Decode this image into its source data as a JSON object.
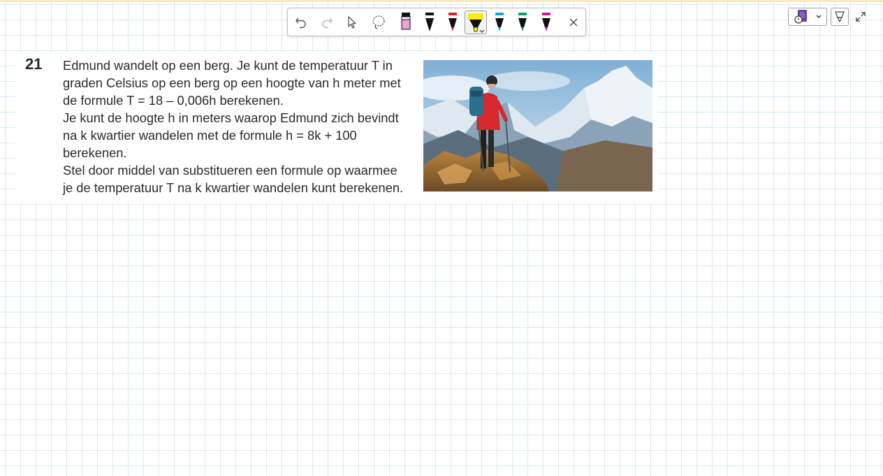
{
  "colors": {
    "grid_line": "#d7e9f5",
    "toolbar_border": "#bdbdbd",
    "highlighter_yellow": "#f5f000"
  },
  "toolbar": {
    "tools": [
      {
        "name": "undo-icon"
      },
      {
        "name": "redo-icon"
      },
      {
        "name": "select-pointer-icon"
      },
      {
        "name": "lasso-icon"
      },
      {
        "name": "pen-black-pink-icon",
        "tip": "#111111",
        "body": "#e4a6d6"
      },
      {
        "name": "pen-black-icon",
        "tip": "#111111",
        "body": "#111111"
      },
      {
        "name": "pen-red-icon",
        "tip": "#e02020",
        "body": "#111111"
      },
      {
        "name": "highlighter-yellow-icon",
        "tip": "#f5f000",
        "body": "#111111",
        "selected": true
      },
      {
        "name": "pen-blue-icon",
        "tip": "#1aa3e8",
        "body": "#111111"
      },
      {
        "name": "pen-green-icon",
        "tip": "#12a06a",
        "body": "#111111"
      },
      {
        "name": "pen-magenta-icon",
        "tip": "#d01a9e",
        "body": "#111111"
      },
      {
        "name": "close-icon"
      }
    ]
  },
  "exercise": {
    "number": "21",
    "lines": [
      "Edmund wandelt op een berg. Je kunt de temperatuur T in",
      "graden Celsius op een berg op een hoogte van h meter met",
      "de formule T = 18 – 0,006h berekenen.",
      "Je kunt de hoogte h in meters waarop Edmund zich bevindt",
      "na k kwartier wandelen met de formule h = 8k + 100",
      "berekenen.",
      "Stel door middel van substitueren een formule op waarmee",
      "je de temperatuur T na k kwartier wandelen kunt berekenen."
    ],
    "image_subject": "hiker with backpack on mountain ridge overlooking snowy peaks"
  }
}
